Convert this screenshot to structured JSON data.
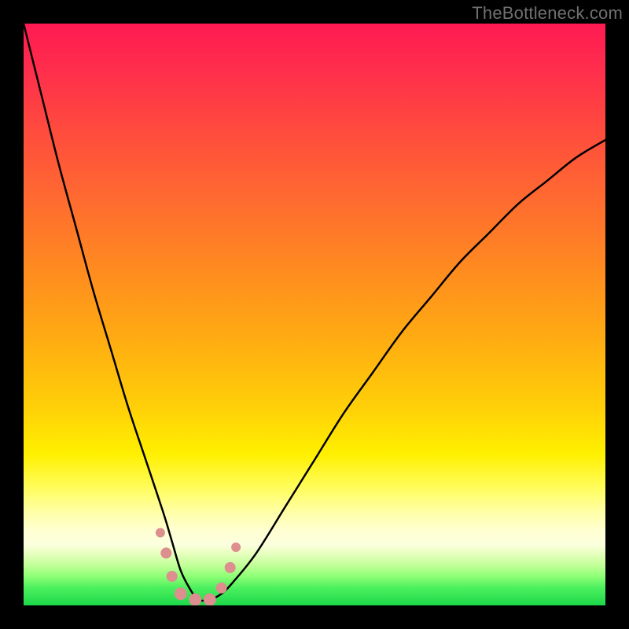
{
  "watermark": "TheBottleneck.com",
  "chart_data": {
    "type": "line",
    "title": "",
    "xlabel": "",
    "ylabel": "",
    "xlim": [
      0,
      100
    ],
    "ylim": [
      0,
      100
    ],
    "grid": false,
    "legend": false,
    "series": [
      {
        "name": "bottleneck-curve",
        "x": [
          0,
          3,
          6,
          9,
          12,
          15,
          18,
          21,
          24,
          25.5,
          27,
          28.5,
          30,
          32,
          34,
          36,
          40,
          45,
          50,
          55,
          60,
          65,
          70,
          75,
          80,
          85,
          90,
          95,
          100
        ],
        "y": [
          100,
          88,
          76,
          65,
          54,
          44,
          34,
          25,
          16,
          11,
          6,
          3,
          1,
          1,
          2,
          4,
          9,
          17,
          25,
          33,
          40,
          47,
          53,
          59,
          64,
          69,
          73,
          77,
          80
        ]
      }
    ],
    "markers": [
      {
        "name": "marker",
        "color": "#dd8e8e",
        "x": 23.5,
        "y": 12.5,
        "size": 12
      },
      {
        "name": "marker",
        "color": "#dd8e8e",
        "x": 24.5,
        "y": 9.0,
        "size": 14
      },
      {
        "name": "marker",
        "color": "#dd8e8e",
        "x": 25.5,
        "y": 5.0,
        "size": 14
      },
      {
        "name": "marker",
        "color": "#dd8e8e",
        "x": 27.0,
        "y": 2.0,
        "size": 16
      },
      {
        "name": "marker",
        "color": "#dd8e8e",
        "x": 29.5,
        "y": 1.0,
        "size": 16
      },
      {
        "name": "marker",
        "color": "#dd8e8e",
        "x": 32.0,
        "y": 1.0,
        "size": 16
      },
      {
        "name": "marker",
        "color": "#dd8e8e",
        "x": 34.0,
        "y": 3.0,
        "size": 14
      },
      {
        "name": "marker",
        "color": "#dd8e8e",
        "x": 35.5,
        "y": 6.5,
        "size": 14
      },
      {
        "name": "marker",
        "color": "#dd8e8e",
        "x": 36.5,
        "y": 10.0,
        "size": 12
      }
    ],
    "background_gradient": {
      "orientation": "vertical",
      "stops": [
        {
          "pos": 0.0,
          "color": "#ff1a52"
        },
        {
          "pos": 0.3,
          "color": "#ff6a30"
        },
        {
          "pos": 0.66,
          "color": "#ffd008"
        },
        {
          "pos": 0.8,
          "color": "#fffd60"
        },
        {
          "pos": 0.9,
          "color": "#e8ffc0"
        },
        {
          "pos": 1.0,
          "color": "#1cd84a"
        }
      ]
    }
  }
}
